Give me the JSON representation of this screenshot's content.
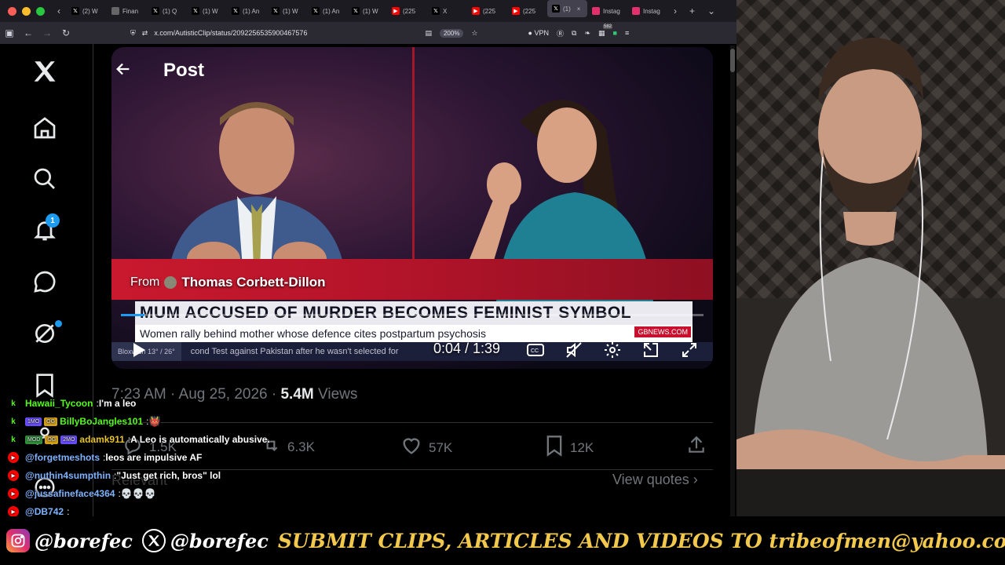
{
  "browser": {
    "tabs": [
      {
        "label": "(2) W",
        "fav": "x"
      },
      {
        "label": "Finan",
        "fav": "blank"
      },
      {
        "label": "(1) Q",
        "fav": "x"
      },
      {
        "label": "(1) W",
        "fav": "x"
      },
      {
        "label": "(1) An",
        "fav": "x"
      },
      {
        "label": "(1) W",
        "fav": "x"
      },
      {
        "label": "(1) An",
        "fav": "x"
      },
      {
        "label": "(1) W",
        "fav": "x"
      },
      {
        "label": "(225",
        "fav": "yt"
      },
      {
        "label": "X",
        "fav": "x"
      },
      {
        "label": "(225",
        "fav": "yt"
      },
      {
        "label": "(225",
        "fav": "yt"
      },
      {
        "label": "(1)",
        "fav": "x",
        "active": true
      },
      {
        "label": "Instag",
        "fav": "ig"
      },
      {
        "label": "Instag",
        "fav": "ig"
      }
    ],
    "url": "x.com/AutisticClip/status/2092256535900467576",
    "zoom": "200%",
    "vpn_label": "VPN",
    "ext_badge": "582"
  },
  "nav": {
    "notifications_badge": "1"
  },
  "post": {
    "header_title": "Post",
    "video": {
      "from_prefix": "From",
      "from_name": "Thomas Corbett-Dillon",
      "headline": "MUM ACCUSED OF MURDER BECOMES FEMINIST SYMBOL",
      "subline": "Women rally behind mother whose defence cites postpartum psychosis",
      "channel": "GBNEWS.COM",
      "ticker_loc": "Bloxwich",
      "ticker_temp": "13° / 26°",
      "ticker_text": "cond Test against Pakistan after he wasn't selected for",
      "time": "0:04 / 1:39",
      "progress_fraction": 0.04
    },
    "timestamp": "7:23 AM · Aug 25, 2026 · ",
    "views_count": "5.4M",
    "views_label": " Views",
    "actions": {
      "replies": "1.5K",
      "reposts": "6.3K",
      "likes": "57K",
      "bookmarks": "12K"
    },
    "view_quotes": "View quotes",
    "relevant": "Relevant"
  },
  "chat": [
    {
      "platform": "kick",
      "user": "Hawaii_Tycoon",
      "color": "#53fc18",
      "badges": [],
      "text": "I'm a leo"
    },
    {
      "platform": "kick",
      "user": "BillyBoJangles101",
      "color": "#53fc18",
      "badges": [
        "1MO",
        "OG"
      ],
      "text": "👹"
    },
    {
      "platform": "kick",
      "user": "adamk911",
      "color": "#e6c229",
      "badges": [
        "MOD",
        "OG",
        "2MO"
      ],
      "text": "A Leo is automatically abusive."
    },
    {
      "platform": "youtube",
      "user": "@forgetmeshots",
      "color": "#7fb3ff",
      "badges": [],
      "text": "leos are impulsive AF"
    },
    {
      "platform": "youtube",
      "user": "@nuthin4sumpthin",
      "color": "#7fb3ff",
      "badges": [],
      "text": "\"Just get rich, bros\" lol"
    },
    {
      "platform": "youtube",
      "user": "@jussafineface4364",
      "color": "#7fb3ff",
      "badges": [],
      "text": "💀💀💀"
    },
    {
      "platform": "youtube",
      "user": "@DB742",
      "color": "#7fb3ff",
      "badges": [],
      "text": ""
    }
  ],
  "banner": {
    "instagram_handle": "@borefec",
    "x_handle": "@borefec",
    "cta": "SUBMIT CLIPS, ARTICLES AND VIDEOS TO tribeofmen@yahoo.com"
  }
}
